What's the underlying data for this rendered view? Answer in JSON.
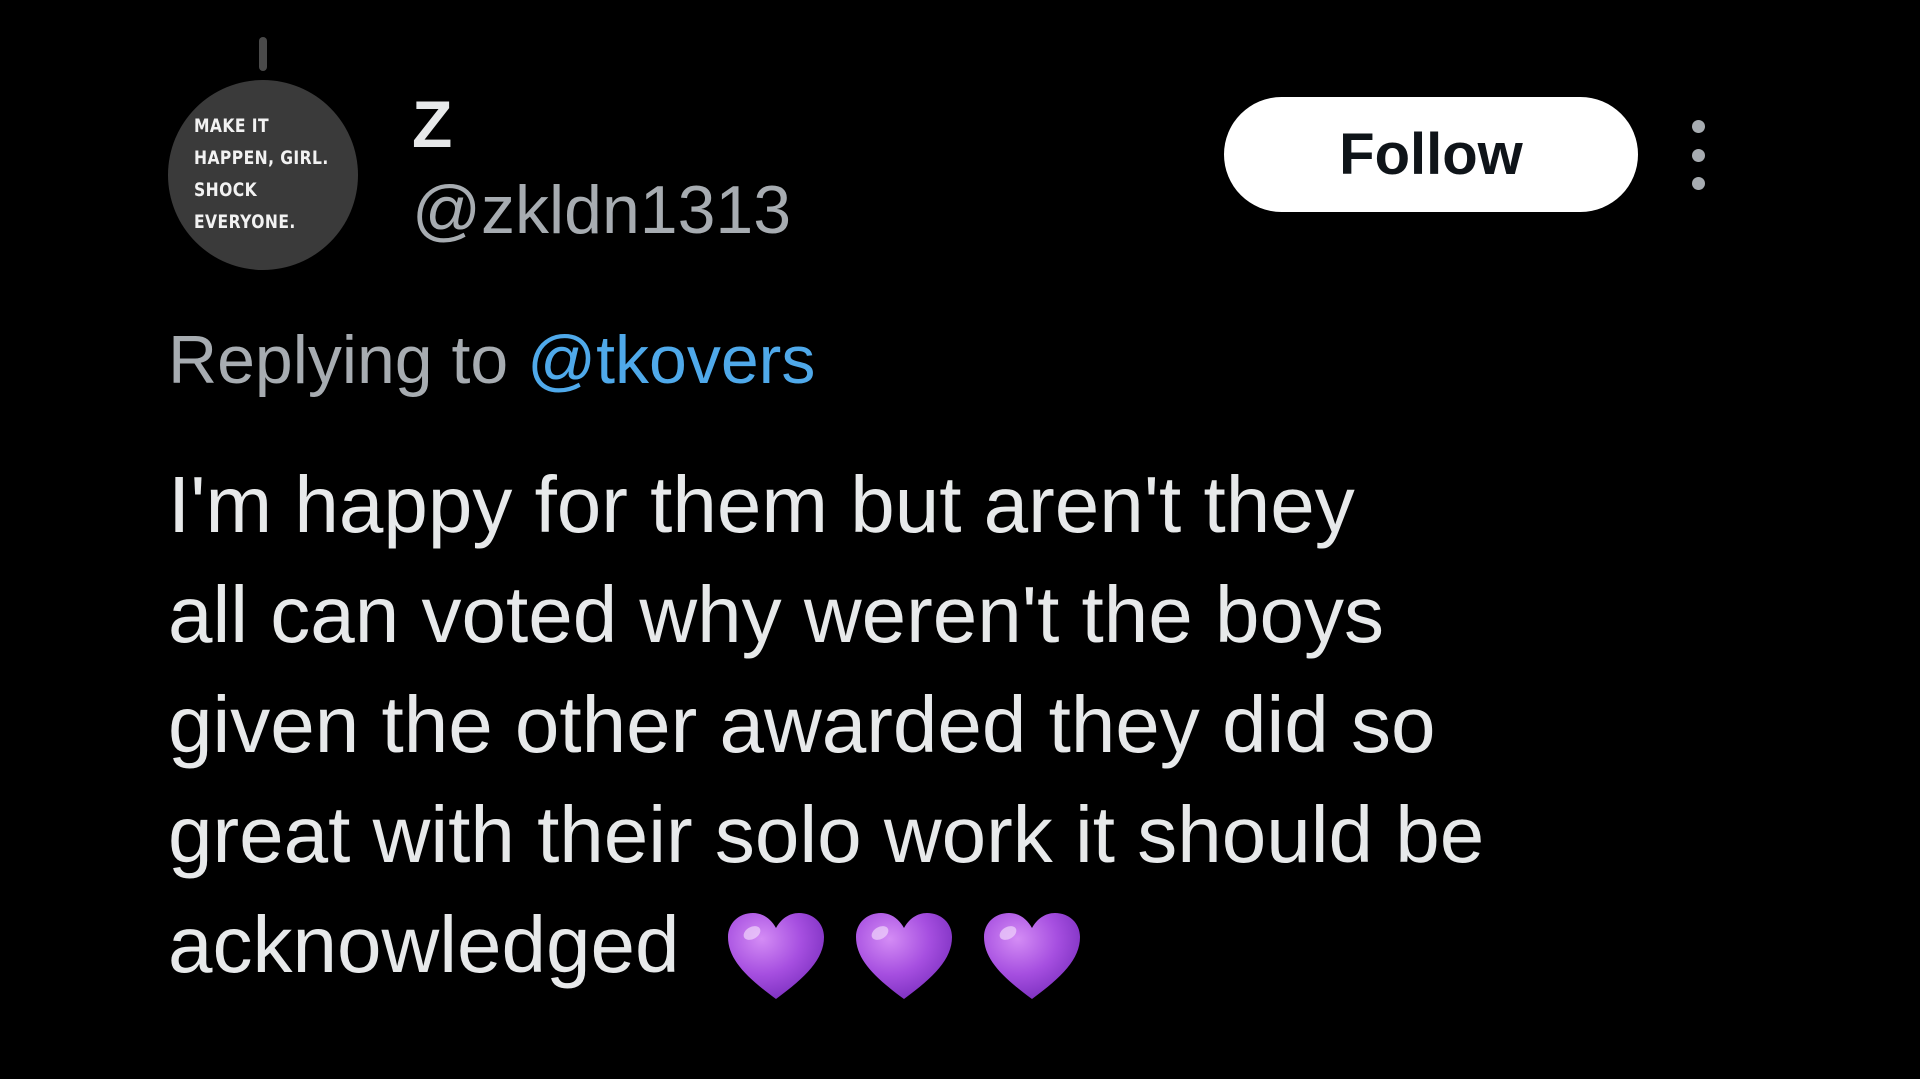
{
  "tweet": {
    "author": {
      "display_name": "Z",
      "handle": "@zkldn1313",
      "avatar_text": [
        "MAKE IT",
        "HAPPEN, GIRL.",
        "SHOCK",
        "EVERYONE."
      ]
    },
    "follow_label": "Follow",
    "more_icon": "more-vertical-icon",
    "replying_prefix": "Replying to",
    "replying_to": "@tkovers",
    "body_lines": [
      "I'm happy for them but aren't they",
      "all can voted why weren't the boys",
      "given the other awarded they did so",
      "great with their solo work it should be",
      "acknowledged"
    ],
    "emoji": [
      "purple-heart-icon",
      "purple-heart-icon",
      "purple-heart-icon"
    ]
  },
  "colors": {
    "background": "#000000",
    "primary_text": "#e7e9ea",
    "secondary_text": "#a7acb1",
    "link": "#4fa9ea",
    "heart": "#a64fe0"
  }
}
